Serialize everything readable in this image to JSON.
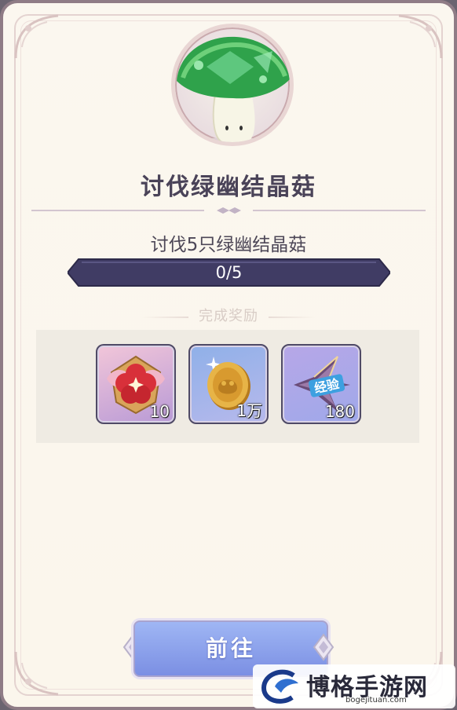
{
  "quest": {
    "title": "讨伐绿幽结晶菇",
    "description": "讨伐5只绿幽结晶菇",
    "progress_text": "0/5",
    "progress_current": 0,
    "progress_total": 5
  },
  "rewards": {
    "label": "完成奖励",
    "items": [
      {
        "icon": "flower-emblem-icon",
        "quantity": "10"
      },
      {
        "icon": "gold-coin-icon",
        "quantity": "1万"
      },
      {
        "icon": "experience-icon",
        "badge_text": "经验",
        "quantity": "180"
      }
    ]
  },
  "actions": {
    "go_label": "前往"
  },
  "watermark": {
    "brand": "博格手游网",
    "url": "bogejituan.com"
  },
  "colors": {
    "title": "#4a4358",
    "progress_bar": "#3f3b63",
    "button": "#8ea3ec",
    "background": "#fbf7ef"
  }
}
